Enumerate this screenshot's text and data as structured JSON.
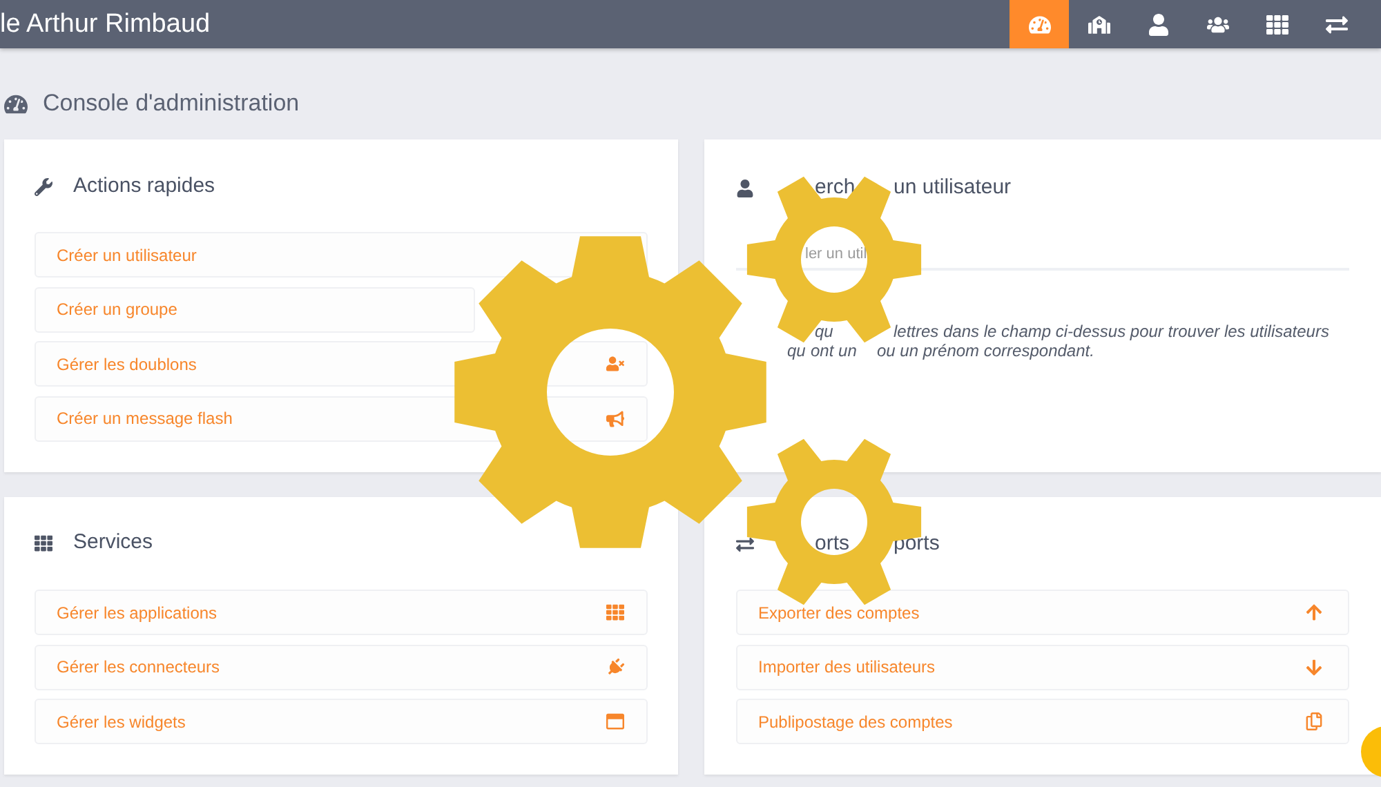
{
  "header": {
    "title": "le Arthur Rimbaud",
    "nav": [
      {
        "selected": true
      },
      {
        "selected": false
      },
      {
        "selected": false
      },
      {
        "selected": false
      },
      {
        "selected": false
      },
      {
        "selected": false
      }
    ]
  },
  "page_title": "Console d'administration",
  "quick_actions": {
    "title": "Actions rapides",
    "links": [
      "Créer un utilisateur",
      "Créer un groupe",
      "Gérer les doublons",
      "Créer un message flash"
    ]
  },
  "user_search": {
    "title_parts": [
      "erch",
      "un utilisateur"
    ],
    "placeholder": "ler un util",
    "hint_lines": [
      [
        "qu",
        "lettres dans le champ ci-dessus pour trouver les utilisateurs"
      ],
      [
        "qu",
        "ont un",
        "ou un prénom correspondant."
      ]
    ]
  },
  "services": {
    "title": "Services",
    "links": [
      "Gérer les applications",
      "Gérer les connecteurs",
      "Gérer les widgets"
    ]
  },
  "imports_exports": {
    "title_parts": [
      "orts",
      "ports"
    ],
    "links": [
      "Exporter des comptes",
      "Importer des utilisateurs",
      "Publipostage des comptes"
    ]
  }
}
